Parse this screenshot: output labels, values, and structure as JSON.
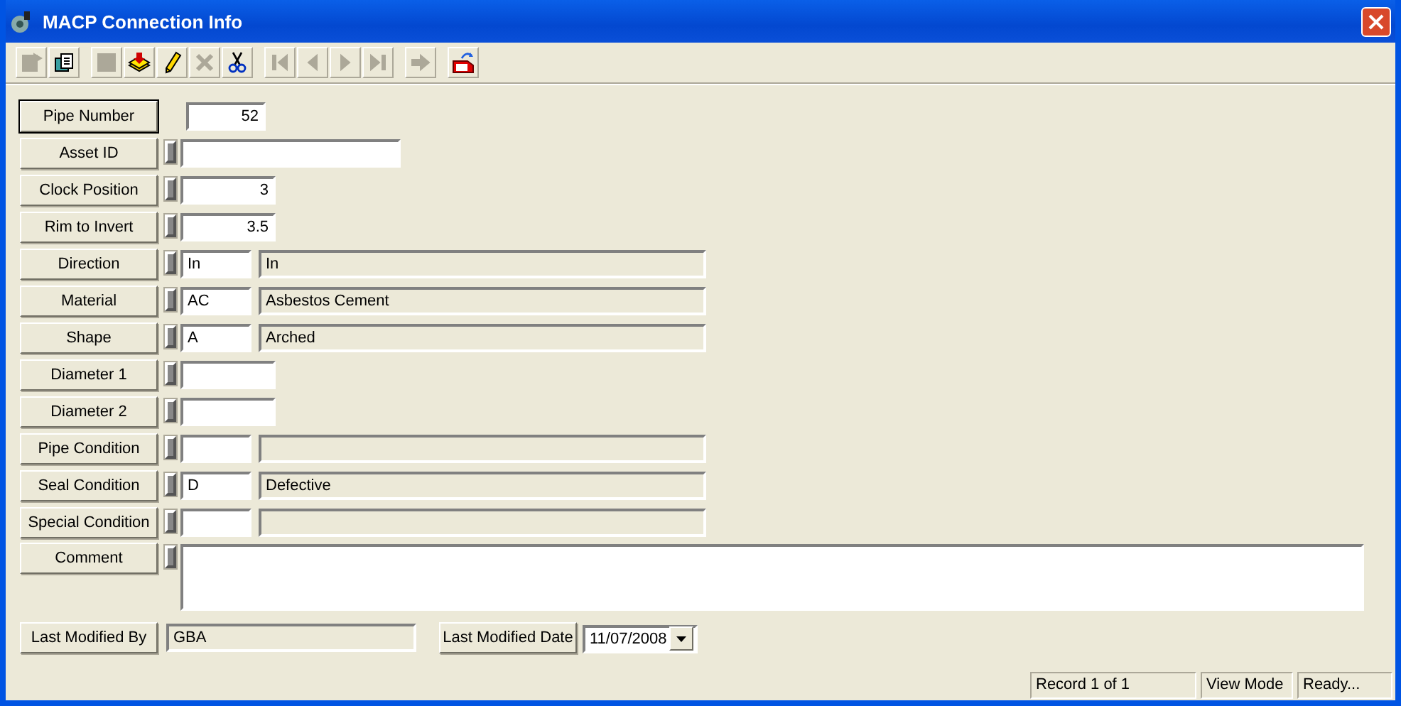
{
  "window": {
    "title": "MACP Connection Info"
  },
  "toolbar": {
    "groups": [
      {
        "tools": [
          {
            "kind": "properties",
            "disabled": true
          },
          {
            "kind": "copy",
            "disabled": false
          }
        ]
      },
      {
        "tools": [
          {
            "kind": "save",
            "disabled": true
          },
          {
            "kind": "load",
            "disabled": false
          },
          {
            "kind": "edit",
            "disabled": false
          },
          {
            "kind": "delete",
            "disabled": true
          },
          {
            "kind": "cut",
            "disabled": false
          }
        ]
      },
      {
        "tools": [
          {
            "kind": "first",
            "disabled": true
          },
          {
            "kind": "prev",
            "disabled": true
          },
          {
            "kind": "next",
            "disabled": true
          },
          {
            "kind": "last",
            "disabled": true
          }
        ]
      },
      {
        "tools": [
          {
            "kind": "go",
            "disabled": true
          }
        ]
      },
      {
        "tools": [
          {
            "kind": "export",
            "disabled": false
          }
        ]
      }
    ]
  },
  "form": {
    "rows": [
      {
        "label": "Pipe Number",
        "kind": "number",
        "indicator": false,
        "focused": true,
        "value": "52"
      },
      {
        "label": "Asset ID",
        "kind": "text",
        "indicator": true,
        "focused": false,
        "value": ""
      },
      {
        "label": "Clock Position",
        "kind": "short",
        "indicator": true,
        "focused": false,
        "value": "3"
      },
      {
        "label": "Rim to Invert",
        "kind": "short",
        "indicator": true,
        "focused": false,
        "value": "3.5"
      },
      {
        "label": "Direction",
        "kind": "lookup",
        "indicator": true,
        "focused": false,
        "value": "In",
        "description": "In"
      },
      {
        "label": "Material",
        "kind": "lookup",
        "indicator": true,
        "focused": false,
        "value": "AC",
        "description": "Asbestos Cement"
      },
      {
        "label": "Shape",
        "kind": "lookup",
        "indicator": true,
        "focused": false,
        "value": "A",
        "description": "Arched"
      },
      {
        "label": "Diameter 1",
        "kind": "short",
        "indicator": true,
        "focused": false,
        "value": ""
      },
      {
        "label": "Diameter 2",
        "kind": "short",
        "indicator": true,
        "focused": false,
        "value": ""
      },
      {
        "label": "Pipe Condition",
        "kind": "lookup",
        "indicator": true,
        "focused": false,
        "value": "",
        "description": ""
      },
      {
        "label": "Seal Condition",
        "kind": "lookup",
        "indicator": true,
        "focused": false,
        "value": "D",
        "description": "Defective"
      },
      {
        "label": "Special Condition",
        "kind": "lookup",
        "indicator": true,
        "focused": false,
        "value": "",
        "description": ""
      },
      {
        "label": "Comment",
        "kind": "memo",
        "indicator": true,
        "focused": false,
        "value": ""
      }
    ],
    "last_modified_by": {
      "label": "Last Modified By",
      "value": "GBA"
    },
    "last_modified_date": {
      "label": "Last Modified Date",
      "value": "11/07/2008"
    }
  },
  "status_bar": [
    "Record 1 of 1",
    "View Mode",
    "Ready..."
  ]
}
